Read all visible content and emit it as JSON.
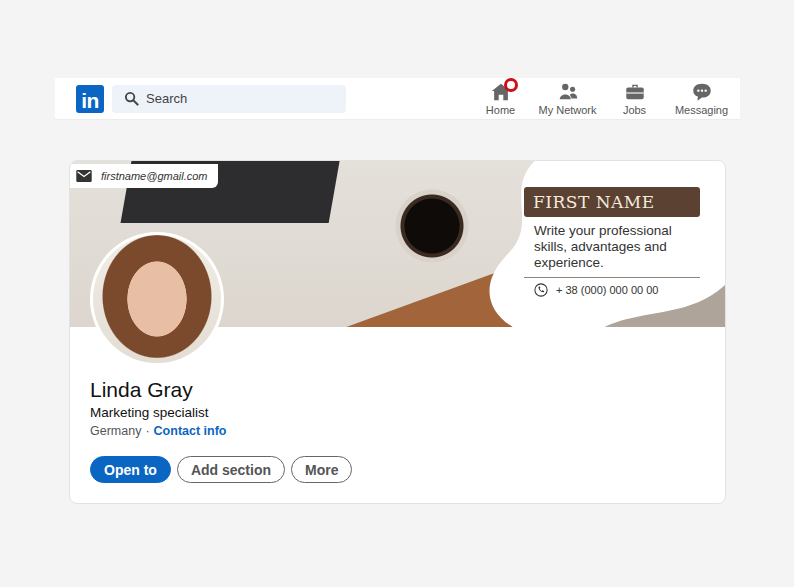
{
  "logo": "in",
  "search": {
    "placeholder": "Search"
  },
  "nav": [
    {
      "label": "Home",
      "badge": true
    },
    {
      "label": "My Network",
      "badge": false
    },
    {
      "label": "Jobs",
      "badge": false
    },
    {
      "label": "Messaging",
      "badge": false
    }
  ],
  "banner": {
    "email": "firstname@gmail.com",
    "title": "FIRST NAME",
    "text": "Write your professional skills, advantages and experience.",
    "phone": "+ 38 (000) 000 00 00"
  },
  "profile": {
    "name": "Linda Gray",
    "headline": "Marketing specialist",
    "location": "Germany",
    "separator": "·",
    "contact_link": "Contact info"
  },
  "actions": [
    {
      "label": "Open to",
      "kind": "primary"
    },
    {
      "label": "Add section",
      "kind": "secondary"
    },
    {
      "label": "More",
      "kind": "secondary"
    }
  ]
}
